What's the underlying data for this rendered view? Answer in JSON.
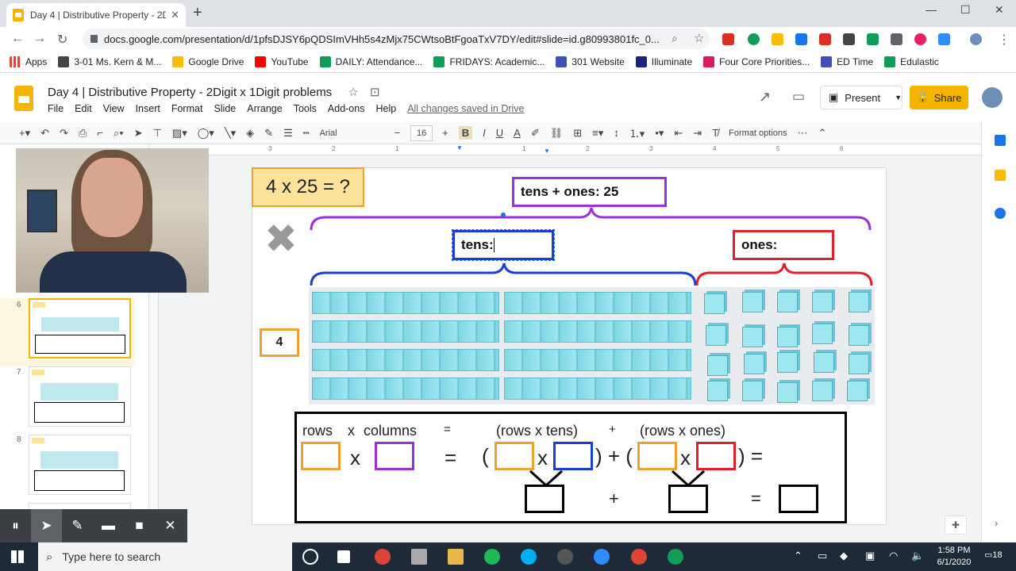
{
  "browser": {
    "tab_title": "Day 4 | Distributive Property - 2D",
    "tab_close": "✕",
    "new_tab": "+",
    "url": "docs.google.com/presentation/d/1pfsDJSY6pQDSImVHh5s4zMjx75CWtsoBtFgoaTxV7DY/edit#slide=id.g80993801fc_0...",
    "window_controls": [
      "—",
      "☐",
      "✕"
    ]
  },
  "bookmarks": [
    {
      "label": "Apps",
      "color": "#ea4335"
    },
    {
      "label": "3-01 Ms. Kern & M...",
      "color": "#444444"
    },
    {
      "label": "Google Drive",
      "color": "#fbbc04"
    },
    {
      "label": "YouTube",
      "color": "#ff0000"
    },
    {
      "label": "DAILY: Attendance...",
      "color": "#0f9d58"
    },
    {
      "label": "FRIDAYS: Academic...",
      "color": "#0f9d58"
    },
    {
      "label": "301 Website",
      "color": "#3f51b5"
    },
    {
      "label": "Illuminate",
      "color": "#1a237e"
    },
    {
      "label": "Four Core Priorities...",
      "color": "#d81b60"
    },
    {
      "label": "ED Time",
      "color": "#3f51b5"
    },
    {
      "label": "Edulastic",
      "color": "#0f9d58"
    }
  ],
  "doc": {
    "title": "Day 4 | Distributive Property - 2Digit x 1Digit problems",
    "menu": [
      "File",
      "Edit",
      "View",
      "Insert",
      "Format",
      "Slide",
      "Arrange",
      "Tools",
      "Add-ons",
      "Help"
    ],
    "saved_status": "All changes saved in Drive",
    "present_label": "Present",
    "share_label": "Share"
  },
  "toolbar": {
    "font": "Arial",
    "size": "16",
    "format_options": "Format options",
    "bold": "B",
    "italic": "I",
    "underline": "U",
    "text_color": "A"
  },
  "ruler": [
    "3",
    "2",
    "1",
    "1",
    "2",
    "3",
    "4",
    "5",
    "6"
  ],
  "slides": [
    {
      "number": "6",
      "selected": true
    },
    {
      "number": "7",
      "selected": false
    },
    {
      "number": "8",
      "selected": false
    }
  ],
  "slide": {
    "problem": "4 x 25 = ?",
    "tens_ones_label": "tens + ones: 25",
    "tens_label": "tens: ",
    "ones_label": "ones:",
    "multiplier": "4",
    "eq_rows": "rows",
    "eq_x": "x",
    "eq_columns": "columns",
    "eq_equals": "=",
    "eq_rows_tens": "(rows x tens)",
    "eq_plus": "+",
    "eq_rows_ones": "(rows x ones)",
    "eq_line2": [
      "x",
      "=",
      "(",
      "x",
      ") + (",
      "x",
      ") ="
    ],
    "eq_line3": [
      "+",
      "="
    ],
    "colors": {
      "orange": "#f0a030",
      "purple": "#9b30d8",
      "blue": "#1a3fd6",
      "red": "#e0202a",
      "cube": "#9ee6f0"
    }
  },
  "recording_bar": [
    "⏸",
    "➤",
    "✎",
    "▬",
    "■",
    "✕"
  ],
  "taskbar": {
    "search_placeholder": "Type here to search",
    "time": "1:58 PM",
    "date": "6/1/2020",
    "notif": "18"
  }
}
